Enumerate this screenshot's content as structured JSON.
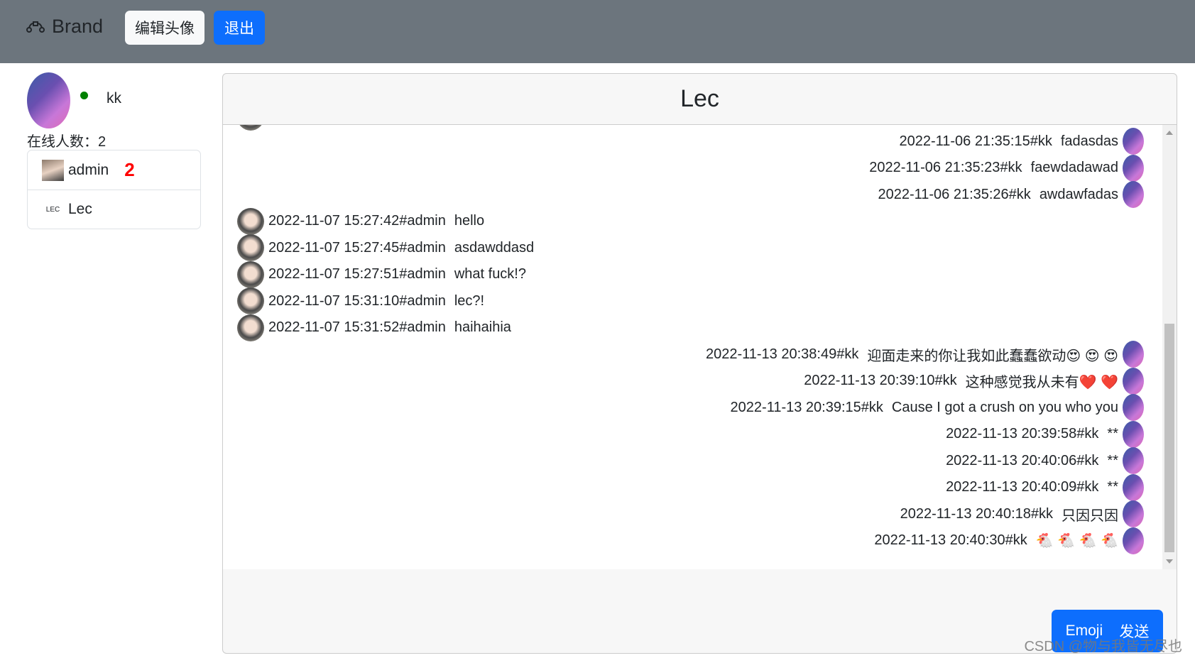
{
  "navbar": {
    "brand": "Brand",
    "edit_avatar": "编辑头像",
    "logout": "退出"
  },
  "me": {
    "name": "kk",
    "status_color": "#008000",
    "online_label": "在线人数：2"
  },
  "contacts": [
    {
      "name": "admin",
      "unread": "2"
    },
    {
      "name": "Lec",
      "mark": "LEC"
    }
  ],
  "chat": {
    "title": "Lec",
    "messages": [
      {
        "side": "right",
        "meta": "2022-11-06 21:35:15#kk",
        "text": "fadasdas"
      },
      {
        "side": "right",
        "meta": "2022-11-06 21:35:23#kk",
        "text": "faewdadawad"
      },
      {
        "side": "right",
        "meta": "2022-11-06 21:35:26#kk",
        "text": "awdawfadas"
      },
      {
        "side": "left",
        "meta": "2022-11-07 15:27:42#admin",
        "text": "hello"
      },
      {
        "side": "left",
        "meta": "2022-11-07 15:27:45#admin",
        "text": "asdawddasd"
      },
      {
        "side": "left",
        "meta": "2022-11-07 15:27:51#admin",
        "text": "what fuck!?"
      },
      {
        "side": "left",
        "meta": "2022-11-07 15:31:10#admin",
        "text": "lec?!"
      },
      {
        "side": "left",
        "meta": "2022-11-07 15:31:52#admin",
        "text": "haihaihia"
      },
      {
        "side": "right",
        "meta": "2022-11-13 20:38:49#kk",
        "text": "迎面走来的你让我如此蠢蠢欲动😍 😍 😍"
      },
      {
        "side": "right",
        "meta": "2022-11-13 20:39:10#kk",
        "text": "这种感觉我从未有❤️ ❤️"
      },
      {
        "side": "right",
        "meta": "2022-11-13 20:39:15#kk",
        "text": "Cause I got a crush on you who you"
      },
      {
        "side": "right",
        "meta": "2022-11-13 20:39:58#kk",
        "text": "**"
      },
      {
        "side": "right",
        "meta": "2022-11-13 20:40:06#kk",
        "text": "**"
      },
      {
        "side": "right",
        "meta": "2022-11-13 20:40:09#kk",
        "text": "**"
      },
      {
        "side": "right",
        "meta": "2022-11-13 20:40:18#kk",
        "text": "只因只因"
      },
      {
        "side": "right",
        "meta": "2022-11-13 20:40:30#kk",
        "text": "🐔 🐔 🐔 🐔"
      }
    ],
    "emoji_label": "Emoji",
    "send_label": "发送"
  },
  "watermark": "CSDN @物与我皆无尽也"
}
